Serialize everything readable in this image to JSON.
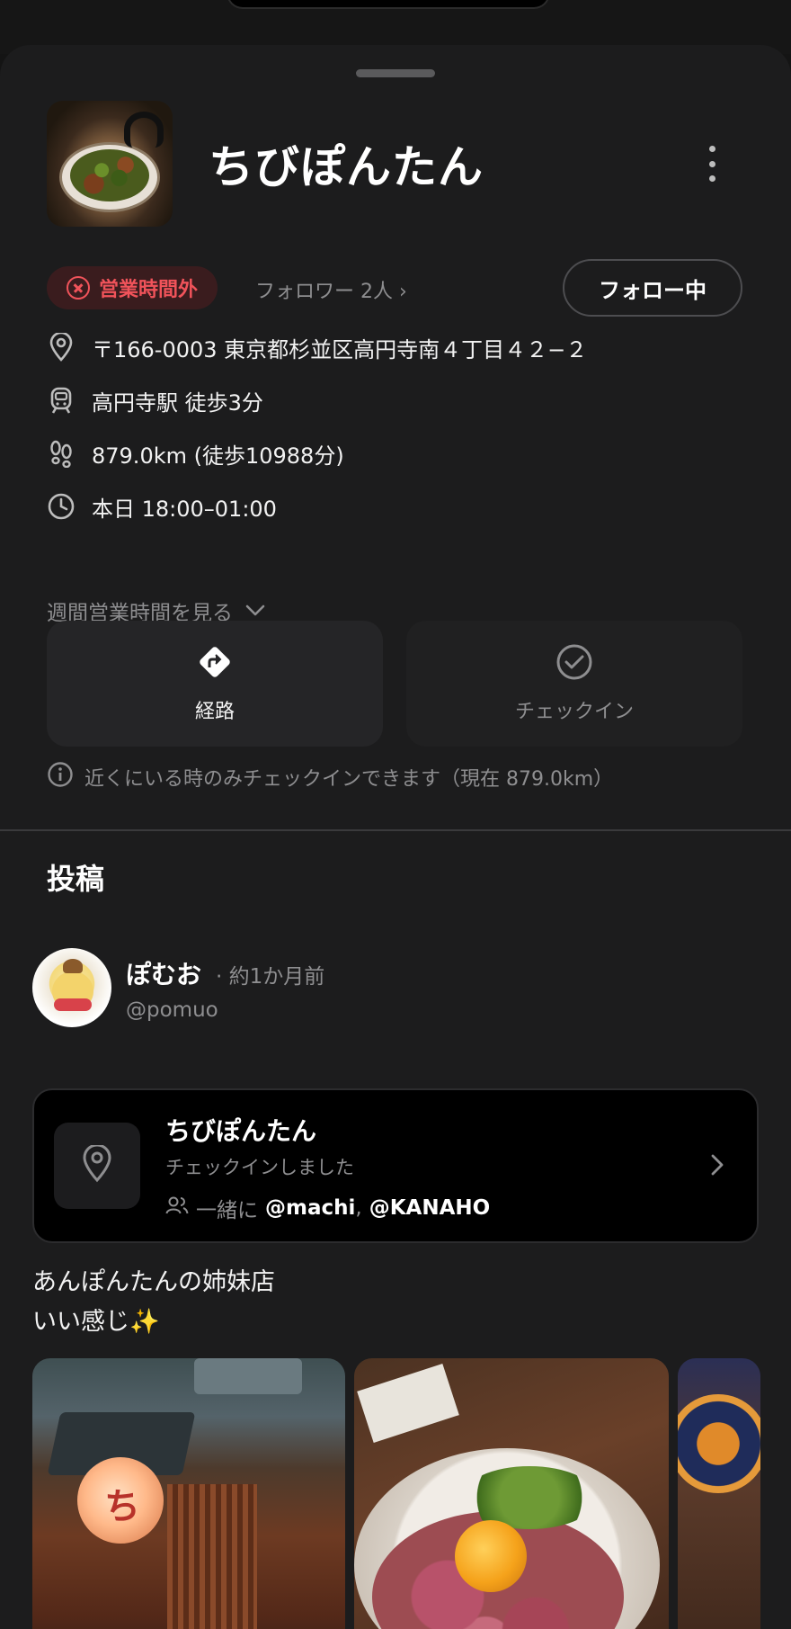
{
  "store": {
    "name": "ちびぽんたん",
    "status": "営業時間外",
    "followers": "フォロワー 2人 ›",
    "follow_button": "フォロー中",
    "address": "〒166-0003 東京都杉並区高円寺南４丁目４２−２",
    "station": "高円寺駅 徒歩3分",
    "distance": "879.0km (徒歩10988分)",
    "hours": "本日 18:00–01:00",
    "weekly_hours_link": "週間営業時間を見る"
  },
  "actions": {
    "route_label": "経路",
    "checkin_label": "チェックイン"
  },
  "checkin_note": "近くにいる時のみチェックインできます（現在 879.0km）",
  "posts_section": {
    "title": "投稿"
  },
  "post": {
    "user_name": "ぽむお",
    "time": "· 約1か月前",
    "handle": "@pomuo",
    "checkin": {
      "place": "ちびぽんたん",
      "subtitle": "チェックインしました",
      "with_label": "一緒に",
      "mention_1": "@machi",
      "separator": ",",
      "mention_2": "@KANAHO"
    },
    "text_line_1": "あんぽんたんの姉妹店",
    "text_line_2": "いい感じ✨",
    "lantern_char": "ち"
  },
  "colors": {
    "background": "#1c1c1d",
    "status_red": "#f0535a",
    "muted": "#8e8e90"
  },
  "icons": [
    "more-icon",
    "close-circle-icon",
    "location-pin-icon",
    "train-icon",
    "footsteps-icon",
    "clock-icon",
    "chevron-down-icon",
    "route-icon",
    "check-circle-icon",
    "info-icon",
    "users-icon",
    "chevron-right-icon"
  ]
}
